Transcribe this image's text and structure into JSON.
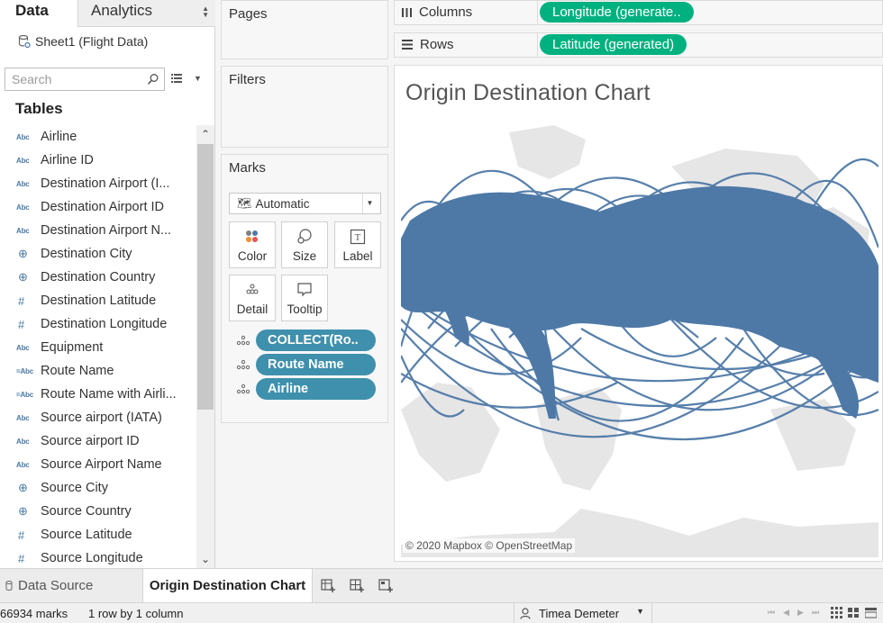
{
  "left_pane": {
    "tab_data": "Data",
    "tab_analytics": "Analytics",
    "datasource": "Sheet1 (Flight Data)",
    "search_placeholder": "Search",
    "tables_heading": "Tables",
    "fields": [
      {
        "type": "Abc",
        "kind": "str",
        "name": "Airline"
      },
      {
        "type": "Abc",
        "kind": "str",
        "name": "Airline ID"
      },
      {
        "type": "Abc",
        "kind": "str",
        "name": "Destination Airport (I..."
      },
      {
        "type": "Abc",
        "kind": "str",
        "name": "Destination Airport ID"
      },
      {
        "type": "Abc",
        "kind": "str",
        "name": "Destination Airport N..."
      },
      {
        "type": "⊕",
        "kind": "geo",
        "name": "Destination City"
      },
      {
        "type": "⊕",
        "kind": "geo",
        "name": "Destination Country"
      },
      {
        "type": "#",
        "kind": "num",
        "name": "Destination Latitude"
      },
      {
        "type": "#",
        "kind": "num",
        "name": "Destination Longitude"
      },
      {
        "type": "Abc",
        "kind": "str",
        "name": "Equipment"
      },
      {
        "type": "=Abc",
        "kind": "str",
        "name": "Route Name"
      },
      {
        "type": "=Abc",
        "kind": "str",
        "name": "Route Name with Airli..."
      },
      {
        "type": "Abc",
        "kind": "str",
        "name": "Source airport (IATA)"
      },
      {
        "type": "Abc",
        "kind": "str",
        "name": "Source airport ID"
      },
      {
        "type": "Abc",
        "kind": "str",
        "name": "Source Airport Name"
      },
      {
        "type": "⊕",
        "kind": "geo",
        "name": "Source City"
      },
      {
        "type": "⊕",
        "kind": "geo",
        "name": "Source Country"
      },
      {
        "type": "#",
        "kind": "num",
        "name": "Source Latitude"
      },
      {
        "type": "#",
        "kind": "num",
        "name": "Source Longitude"
      }
    ]
  },
  "cards": {
    "pages": "Pages",
    "filters": "Filters",
    "marks": "Marks",
    "mark_type": "Automatic",
    "buttons": {
      "color": "Color",
      "size": "Size",
      "label": "Label",
      "detail": "Detail",
      "tooltip": "Tooltip"
    },
    "pills": [
      "COLLECT(Ro..",
      "Route Name",
      "Airline"
    ]
  },
  "shelves": {
    "columns_label": "Columns",
    "columns_pill": "Longitude (generate..",
    "rows_label": "Rows",
    "rows_pill": "Latitude (generated)"
  },
  "view": {
    "title": "Origin Destination Chart",
    "attribution": "© 2020 Mapbox © OpenStreetMap"
  },
  "sheet_tabs": {
    "data_source": "Data Source",
    "active_sheet": "Origin Destination Chart"
  },
  "status": {
    "marks": "66934 marks",
    "dims": "1 row by 1 column",
    "user": "Timea Demeter"
  },
  "colors": {
    "measure_pill": "#3f90ad",
    "generated_pill": "#00b180",
    "route_lines": "#4e79a7",
    "land": "#e6e6e6"
  }
}
